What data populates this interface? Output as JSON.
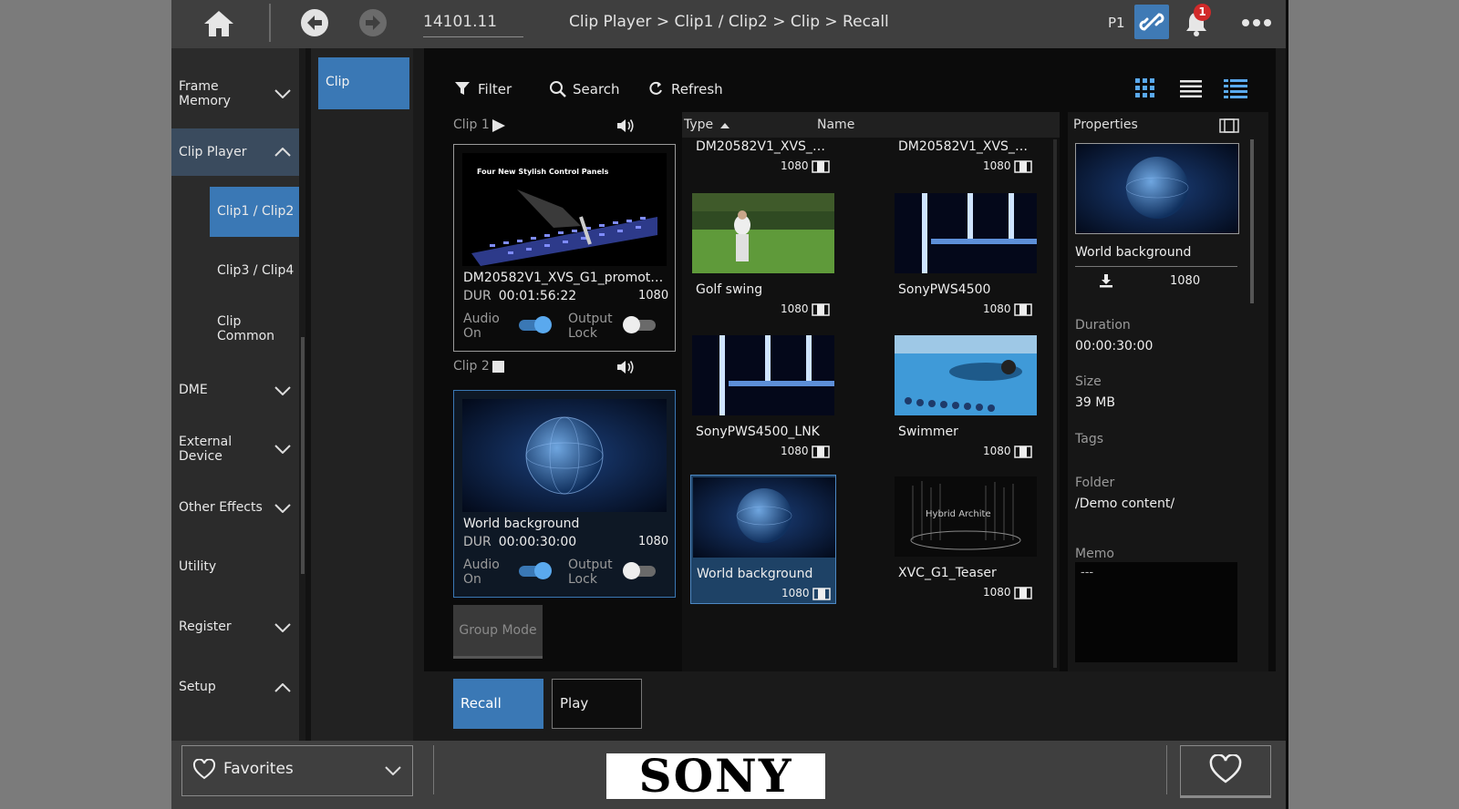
{
  "topbar": {
    "address": "14101.11",
    "breadcrumb": "Clip Player > Clip1 / Clip2 > Clip > Recall",
    "page_indicator": "P1",
    "notification_count": "1"
  },
  "nav": {
    "items": [
      {
        "label": "Frame\nMemory"
      },
      {
        "label": "Clip Player"
      },
      {
        "label": "DME"
      },
      {
        "label": "External\nDevice"
      },
      {
        "label": "Other Effects"
      },
      {
        "label": "Utility"
      },
      {
        "label": "Register"
      },
      {
        "label": "Setup"
      }
    ],
    "subitems": [
      {
        "label": "Clip1 / Clip2"
      },
      {
        "label": "Clip3 / Clip4"
      },
      {
        "label": "Clip\nCommon"
      }
    ]
  },
  "col2": {
    "tab": "Clip"
  },
  "toolbar": {
    "filter": "Filter",
    "search": "Search",
    "refresh": "Refresh"
  },
  "channels": [
    {
      "label": "Clip 1",
      "thumb_caption": "Four New Stylish Control Panels",
      "name": "DM20582V1_XVS_G1_promotio...",
      "dur_label": "DUR",
      "dur": "00:01:56:22",
      "res": "1080",
      "audio_label": "Audio\nOn",
      "audio_on": true,
      "lock_label": "Output\nLock",
      "lock_on": false
    },
    {
      "label": "Clip 2",
      "name": "World background",
      "dur_label": "DUR",
      "dur": "00:00:30:00",
      "res": "1080",
      "audio_label": "Audio\nOn",
      "audio_on": true,
      "lock_label": "Output\nLock",
      "lock_on": false
    }
  ],
  "group_mode": "Group Mode",
  "list": {
    "col_type": "Type",
    "col_name": "Name",
    "items": [
      {
        "name": "DM20582V1_XVS_G...",
        "res": "1080"
      },
      {
        "name": "DM20582V1_XVS_G...",
        "res": "1080"
      },
      {
        "name": "Golf swing",
        "res": "1080"
      },
      {
        "name": "SonyPWS4500",
        "res": "1080"
      },
      {
        "name": "SonyPWS4500_LNK",
        "res": "1080"
      },
      {
        "name": "Swimmer",
        "res": "1080"
      },
      {
        "name": "World background",
        "res": "1080",
        "selected": true
      },
      {
        "name": "XVC_G1_Teaser",
        "res": "1080",
        "thumb_caption": "Hybrid Archite"
      }
    ]
  },
  "properties": {
    "title": "Properties",
    "name": "World background",
    "res": "1080",
    "duration_label": "Duration",
    "duration": "00:00:30:00",
    "size_label": "Size",
    "size": "39 MB",
    "tags_label": "Tags",
    "folder_label": "Folder",
    "folder": "/Demo content/",
    "memo_label": "Memo",
    "memo": "---"
  },
  "actions": {
    "recall": "Recall",
    "play": "Play"
  },
  "bottom": {
    "favorites": "Favorites",
    "logo": "SONY"
  },
  "colors": {
    "accent": "#3a78b5",
    "badge": "#d12a2a"
  }
}
